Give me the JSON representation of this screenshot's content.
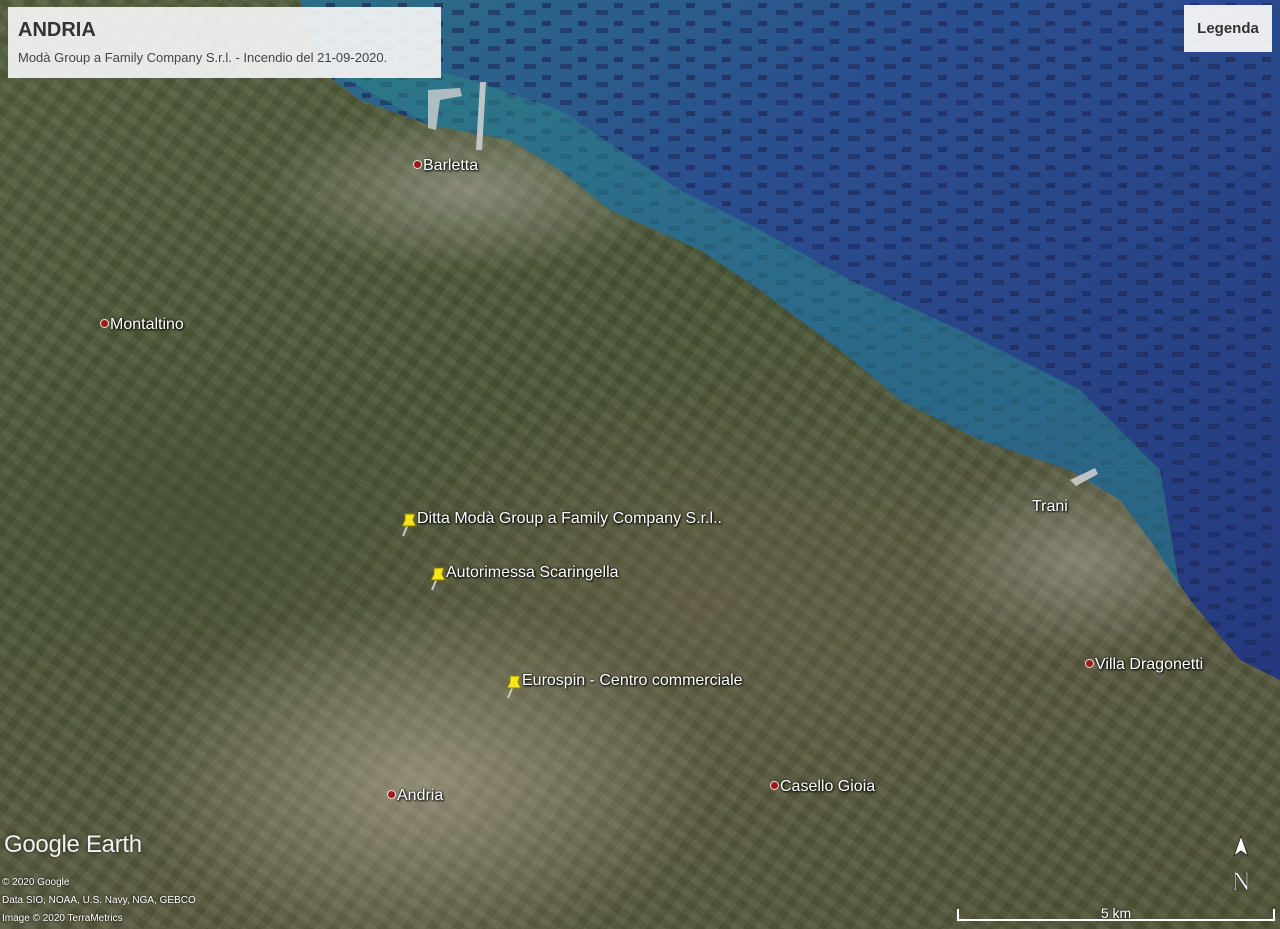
{
  "header": {
    "title": "ANDRIA",
    "subtitle": "Modà Group a Family Company S.r.l. - Incendio del 21-09-2020."
  },
  "legend_button": {
    "label": "Legenda"
  },
  "places": [
    "Barletta",
    "Montaltino",
    "Trani",
    "Villa Dragonetti",
    "Casello Gioia",
    "Andria"
  ],
  "markers": [
    {
      "label": "Ditta Modà Group a Family Company S.r.l..",
      "color": "#f5e51b"
    },
    {
      "label": "Autorimessa Scaringella",
      "color": "#f5e51b"
    },
    {
      "label": "Eurospin - Centro commerciale",
      "color": "#f5e51b"
    }
  ],
  "branding": {
    "logo": "Google Earth"
  },
  "credits": {
    "line1": "© 2020 Google",
    "line2": "Data SIO, NOAA, U.S. Navy, NGA, GEBCO",
    "line3": "Image © 2020 TerraMetrics"
  },
  "compass": {
    "label": "N"
  },
  "scale": {
    "label": "5 km"
  },
  "colors": {
    "sea_deep": "#273a86",
    "sea_shallow": "#2d7f80",
    "marker": "#f5e51b",
    "place_dot": "#9e1a1a"
  }
}
